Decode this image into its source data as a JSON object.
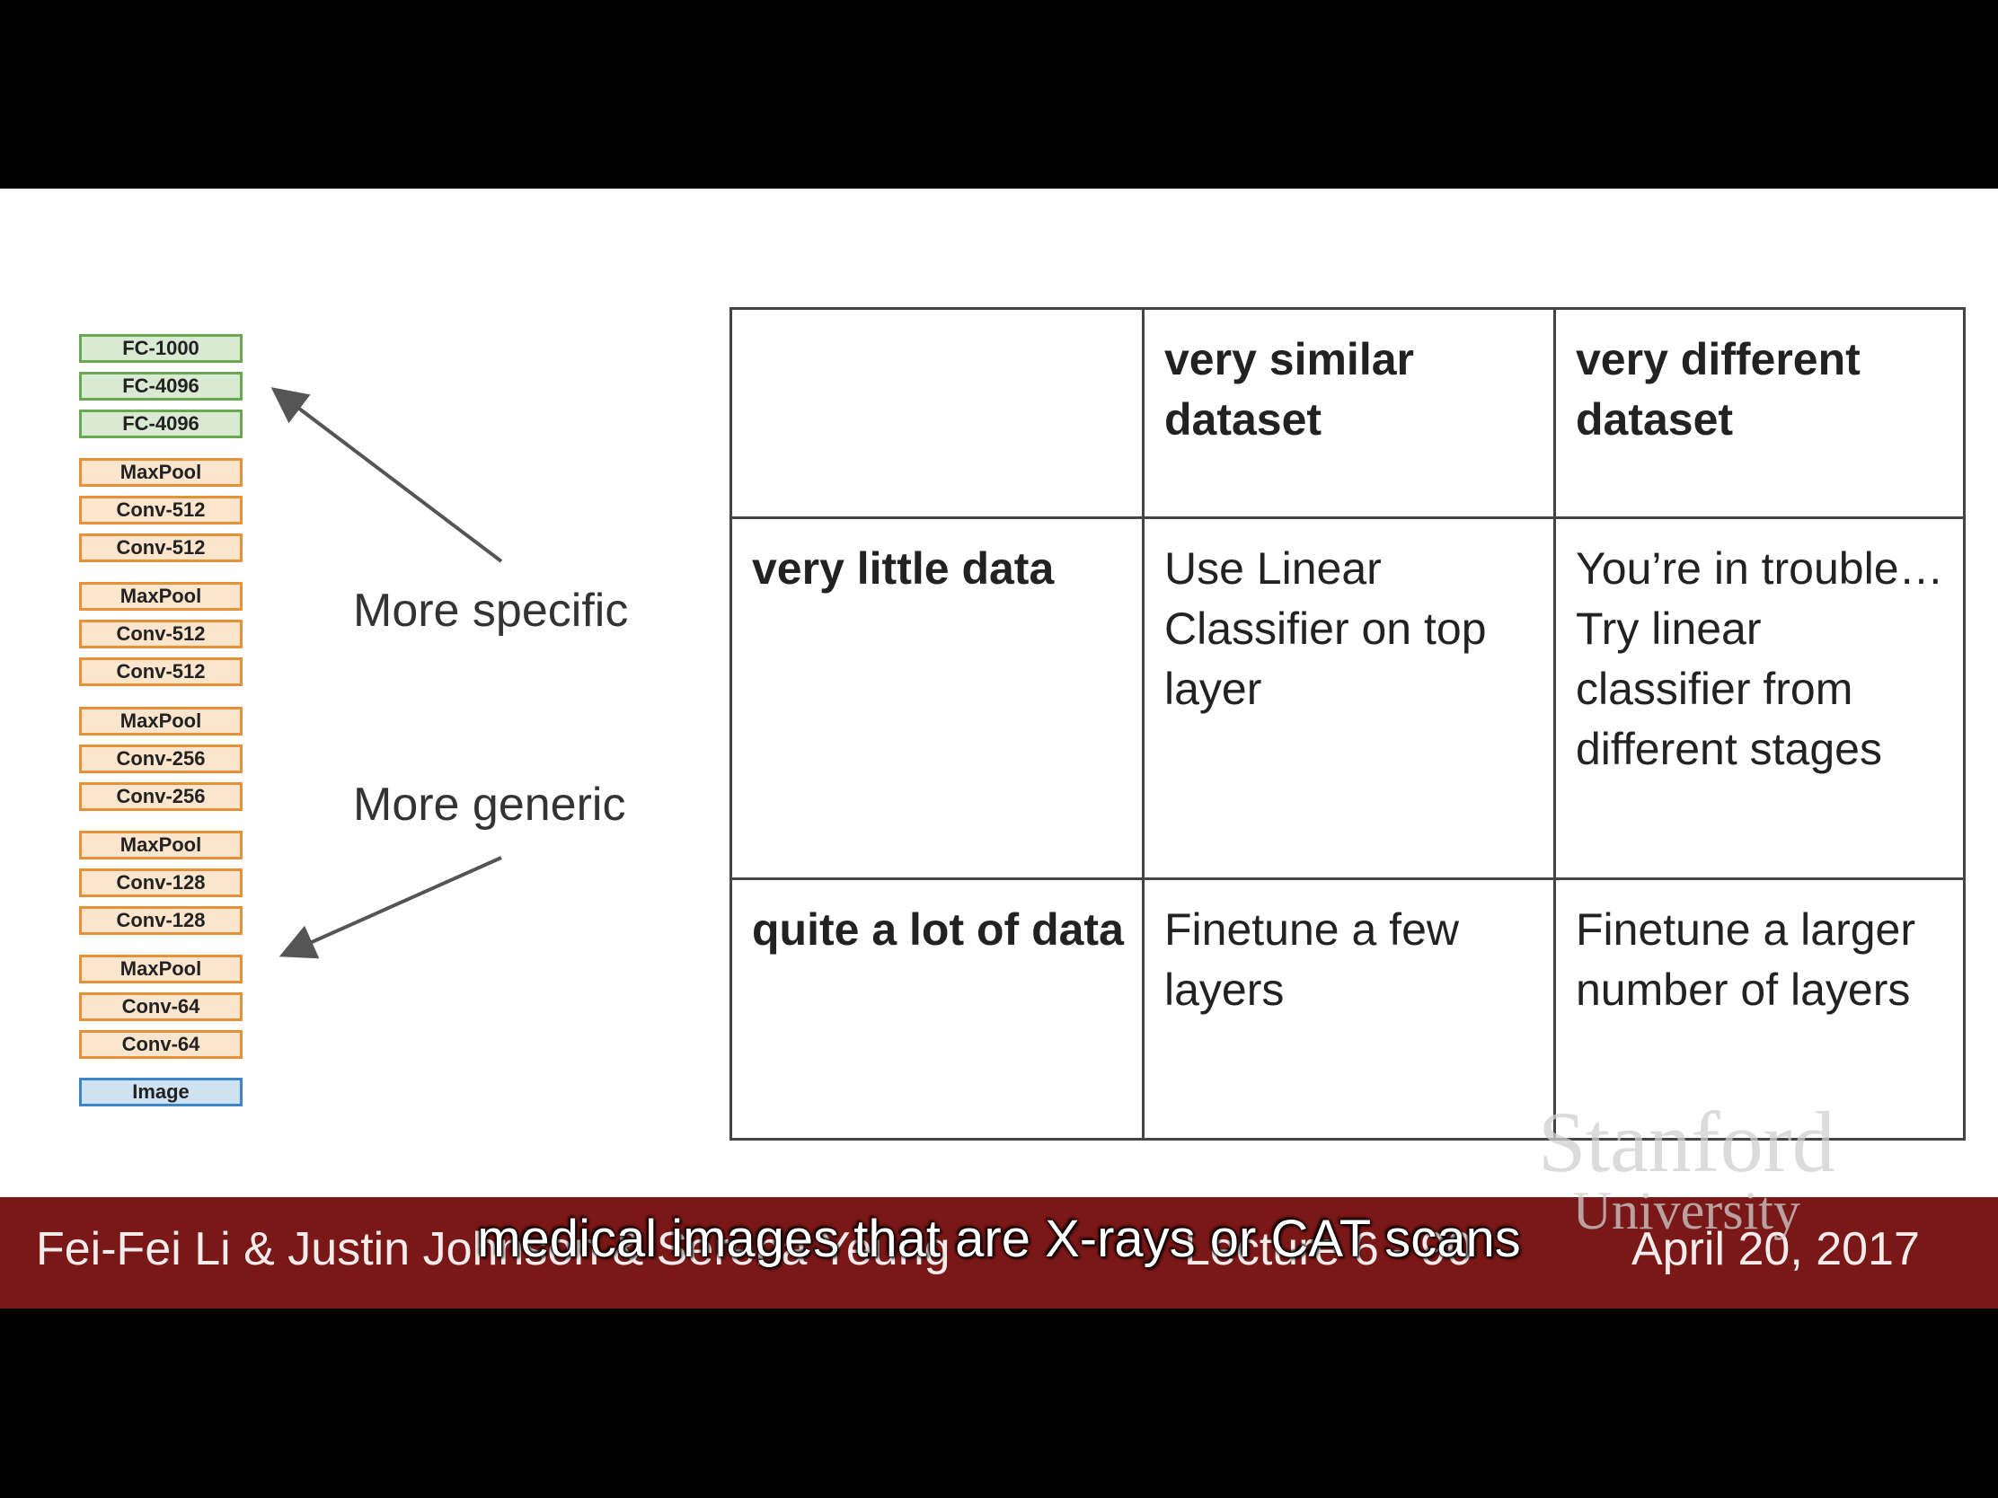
{
  "layers": [
    {
      "label": "FC-1000",
      "kind": "fc"
    },
    {
      "label": "FC-4096",
      "kind": "fc"
    },
    {
      "label": "FC-4096",
      "kind": "fc"
    },
    {
      "label": "MaxPool",
      "kind": "conv"
    },
    {
      "label": "Conv-512",
      "kind": "conv"
    },
    {
      "label": "Conv-512",
      "kind": "conv"
    },
    {
      "label": "MaxPool",
      "kind": "conv"
    },
    {
      "label": "Conv-512",
      "kind": "conv"
    },
    {
      "label": "Conv-512",
      "kind": "conv"
    },
    {
      "label": "MaxPool",
      "kind": "conv"
    },
    {
      "label": "Conv-256",
      "kind": "conv"
    },
    {
      "label": "Conv-256",
      "kind": "conv"
    },
    {
      "label": "MaxPool",
      "kind": "conv"
    },
    {
      "label": "Conv-128",
      "kind": "conv"
    },
    {
      "label": "Conv-128",
      "kind": "conv"
    },
    {
      "label": "MaxPool",
      "kind": "conv"
    },
    {
      "label": "Conv-64",
      "kind": "conv"
    },
    {
      "label": "Conv-64",
      "kind": "conv"
    },
    {
      "label": "Image",
      "kind": "img"
    }
  ],
  "labels": {
    "more_specific": "More specific",
    "more_generic": "More generic"
  },
  "table": {
    "col_headers": [
      "very similar dataset",
      "very different dataset"
    ],
    "rows": [
      {
        "header": "very little data",
        "cells": [
          "Use Linear Classifier on top layer",
          "You’re in trouble… Try linear classifier from different stages"
        ]
      },
      {
        "header": "quite a lot of data",
        "cells": [
          "Finetune a few layers",
          "Finetune a larger number of layers"
        ]
      }
    ]
  },
  "footer": {
    "left": "Fei-Fei Li & Justin Johnson & Serena Yeung",
    "center": "Lecture 6 - 90",
    "right": "April 20, 2017"
  },
  "watermark": {
    "line1": "Stanford",
    "line2": "University"
  },
  "subtitle": "medical images that are X-rays or CAT scans",
  "colors": {
    "footer_bar": "#7a1717",
    "fc": "#6aa84f",
    "conv": "#e69138",
    "image": "#3d85c6"
  }
}
